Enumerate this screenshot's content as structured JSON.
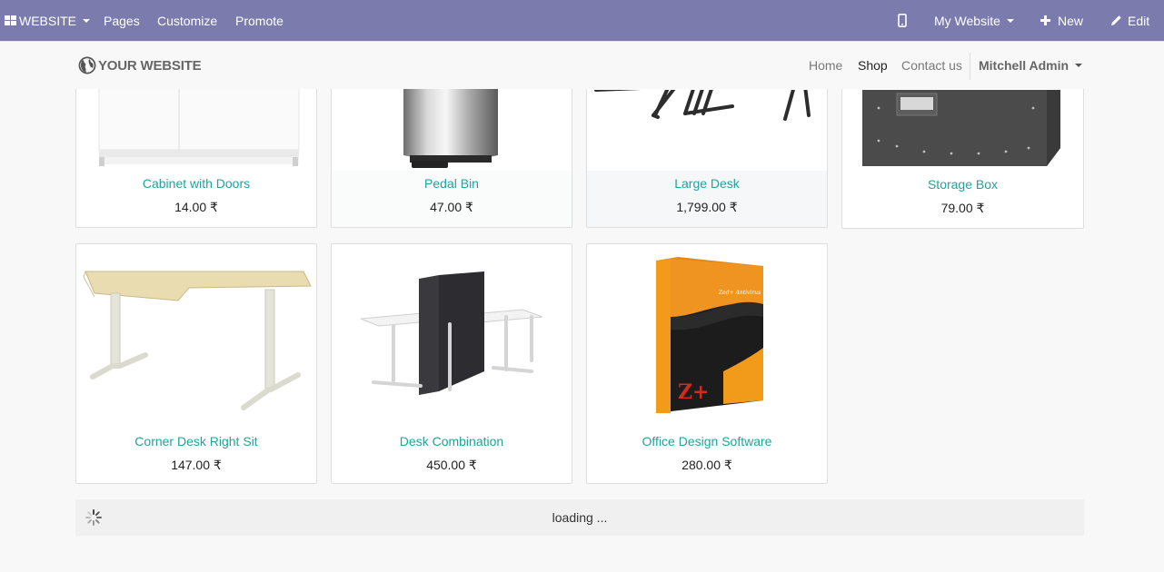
{
  "admin_bar": {
    "website_menu": "WEBSITE",
    "pages": "Pages",
    "customize": "Customize",
    "promote": "Promote",
    "my_website": "My Website",
    "new": "New",
    "edit": "Edit",
    "color": "#7c7bad"
  },
  "navbar": {
    "logo_text": "YOUR WEBSITE",
    "links": [
      "Home",
      "Shop",
      "Contact us"
    ],
    "active": "Shop",
    "user": "Mitchell Admin"
  },
  "products": [
    {
      "name": "Cabinet with Doors",
      "price": "14.00 ₹"
    },
    {
      "name": "Pedal Bin",
      "price": "47.00 ₹"
    },
    {
      "name": "Large Desk",
      "price": "1,799.00 ₹"
    },
    {
      "name": "Storage Box",
      "price": "79.00 ₹"
    },
    {
      "name": "Corner Desk Right Sit",
      "price": "147.00 ₹"
    },
    {
      "name": "Desk Combination",
      "price": "450.00 ₹"
    },
    {
      "name": "Office Design Software",
      "price": "280.00 ₹"
    }
  ],
  "software_box_label": "Zed+ Antivirus",
  "software_box_logo": "Z+",
  "loading_text": "loading ...",
  "accent_color": "#21a39b"
}
